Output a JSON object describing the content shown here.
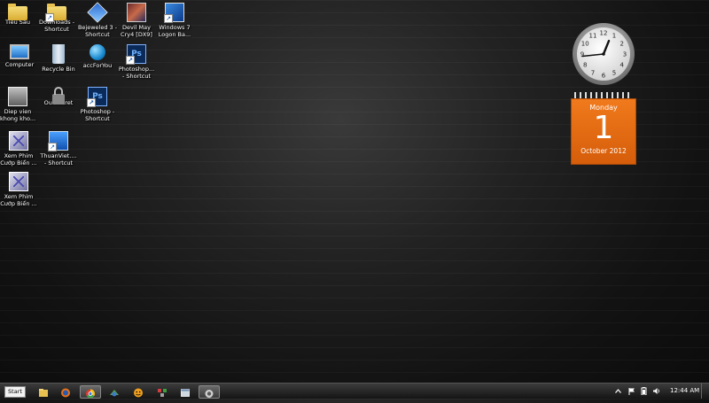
{
  "desktop": {
    "icons": [
      {
        "label": "Tiểu Sầu",
        "icon": "folder-icon"
      },
      {
        "label": "Downloads -\nShortcut",
        "icon": "downloads-folder-icon"
      },
      {
        "label": "Bejeweled 3 -\nShortcut",
        "icon": "bejeweled-icon"
      },
      {
        "label": "Devil May\nCry4 [DX9]",
        "icon": "devil-may-cry-icon"
      },
      {
        "label": "Windows 7\nLogon Ba...",
        "icon": "windows-logon-icon"
      },
      {
        "label": "Computer",
        "icon": "computer-icon"
      },
      {
        "label": "Recycle Bin",
        "icon": "recycle-bin-icon"
      },
      {
        "label": "accForYou",
        "icon": "globe-icon"
      },
      {
        "label": "Photoshop...\n- Shortcut",
        "icon": "photoshop-icon"
      },
      {
        "label": "Diep vien\nkhong kho...",
        "icon": "movie-icon"
      },
      {
        "label": "OurSecret",
        "icon": "lock-icon"
      },
      {
        "label": "Photoshop -\nShortcut",
        "icon": "photoshop-icon"
      },
      {
        "label": "Xem Phim\nCướp Biển ...",
        "icon": "xem-phim-icon"
      },
      {
        "label": "ThuanViet....\n- Shortcut",
        "icon": "thuanviet-icon"
      },
      {
        "label": "Xem Phim\nCướp Biển ...",
        "icon": "xem-phim-icon"
      }
    ]
  },
  "clock_gadget": {
    "hours": 12,
    "minutes": 44,
    "numerals": [
      "12",
      "1",
      "2",
      "3",
      "4",
      "5",
      "6",
      "7",
      "8",
      "9",
      "10",
      "11"
    ]
  },
  "calendar_gadget": {
    "day_of_week": "Monday",
    "day": "1",
    "month_year": "October 2012",
    "color": "#e8690f"
  },
  "taskbar": {
    "start_label": "Start",
    "items": [
      "explorer-icon",
      "firefox-icon",
      "chrome-icon",
      "app-icon",
      "emoticon-icon",
      "app2-icon",
      "window-icon",
      "active-app-icon"
    ],
    "tray_icons": [
      "chevron-up-icon",
      "flag-icon",
      "battery-icon",
      "volume-icon"
    ],
    "time": "12:44 AM"
  }
}
